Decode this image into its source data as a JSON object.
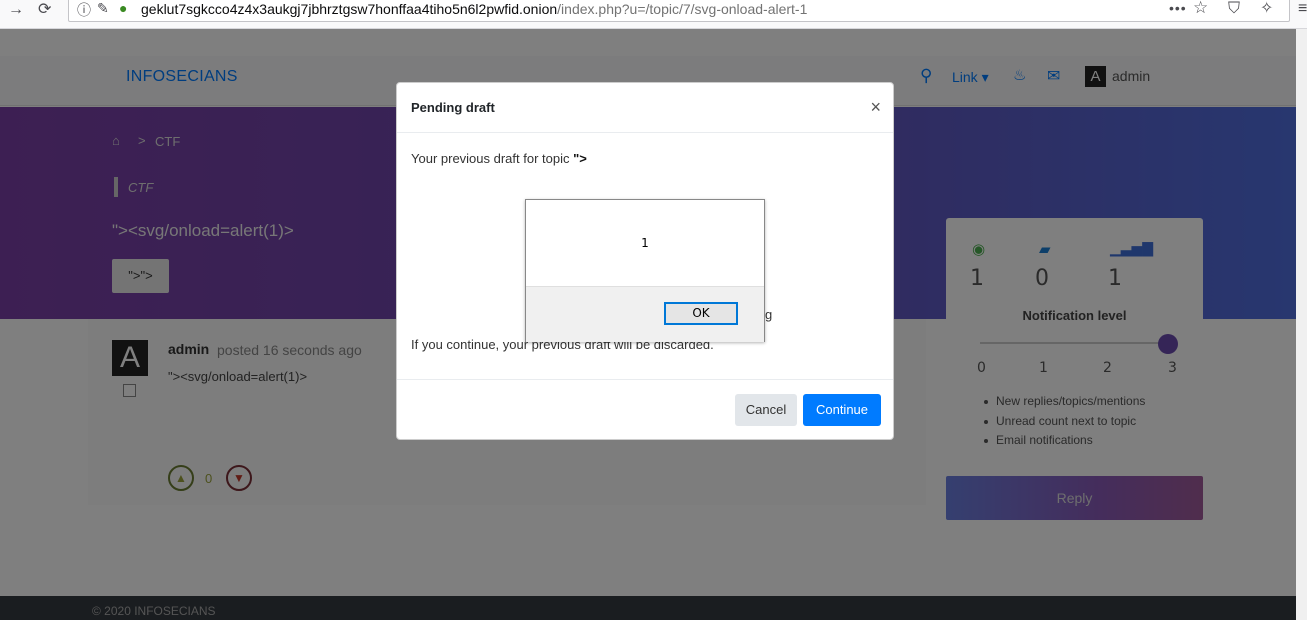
{
  "browser": {
    "url_host": "geklut7sgkcco4z4x3aukgj7jbhrztgsw7honffaa4tiho5n6l2pwfid.onion",
    "url_path": "/index.php?u=/topic/7/svg-onload-alert-1",
    "menu_glyph": "•••"
  },
  "nav": {
    "brand": "INFOSECIANS",
    "link_label": "Link ▾",
    "avatar_letter": "A",
    "user": "admin"
  },
  "hero": {
    "breadcrumb_sep": ">",
    "breadcrumb": "CTF",
    "category": "CTF",
    "title": "\"><svg/onload=alert(1)>",
    "tag": "\">\">"
  },
  "post": {
    "avatar_letter": "A",
    "author": "admin",
    "time": "posted 16 seconds ago",
    "body": "\"><svg/onload=alert(1)>",
    "votes": "0"
  },
  "sidebar": {
    "stats": [
      {
        "icon": "eye-icon",
        "value": "1",
        "color": "#4caf50"
      },
      {
        "icon": "comment-icon",
        "value": "0",
        "color": "#1a7fd4"
      },
      {
        "icon": "signal-icon",
        "value": "1",
        "color": "#3f6fd8"
      }
    ],
    "notif_title": "Notification level",
    "notification_level": 3,
    "ticks": [
      "0",
      "1",
      "2",
      "3"
    ],
    "notif_items": [
      "New replies/topics/mentions",
      "Unread count next to topic",
      "Email notifications"
    ],
    "reply_label": "Reply"
  },
  "footer": {
    "text": "© 2020 INFOSECIANS"
  },
  "modal": {
    "title": "Pending draft",
    "close": "×",
    "line1_prefix": "Your previous draft for topic ",
    "line1_bold": "\">",
    "fragment": "g",
    "line2": "If you continue, your previous draft will be discarded.",
    "cancel": "Cancel",
    "continue": "Continue"
  },
  "alert": {
    "message": "1",
    "ok": "OK"
  }
}
